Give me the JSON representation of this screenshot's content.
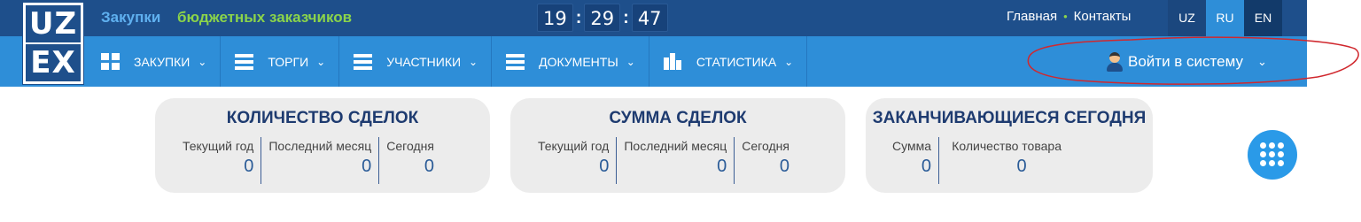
{
  "logo": {
    "line1": "UZ",
    "line2": "EX"
  },
  "brand": {
    "part1": "Закупки",
    "part2": "бюджетных заказчиков"
  },
  "clock": {
    "hours": "19",
    "minutes": "29",
    "seconds": "47",
    "separator": ":"
  },
  "toplinks": {
    "home": "Главная",
    "dot": "•",
    "contacts": "Контакты"
  },
  "languages": {
    "uz": "UZ",
    "ru": "RU",
    "en": "EN",
    "active": "RU"
  },
  "menu": {
    "items": [
      {
        "label": "ЗАКУПКИ",
        "icon": "grid-icon"
      },
      {
        "label": "ТОРГИ",
        "icon": "list-icon"
      },
      {
        "label": "УЧАСТНИКИ",
        "icon": "list-icon"
      },
      {
        "label": "ДОКУМЕНТЫ",
        "icon": "list-icon"
      },
      {
        "label": "СТАТИСТИКА",
        "icon": "bar-chart-icon"
      }
    ],
    "chevron": "⌄"
  },
  "login": {
    "label": "Войти в систему",
    "icon": "user-icon"
  },
  "cards": [
    {
      "title": "КОЛИЧЕСТВО СДЕЛОК",
      "columns": [
        {
          "label": "Текущий год",
          "value": "0"
        },
        {
          "label": "Последний месяц",
          "value": "0"
        },
        {
          "label": "Сегодня",
          "value": "0"
        }
      ]
    },
    {
      "title": "СУММА СДЕЛОК",
      "columns": [
        {
          "label": "Текущий год",
          "value": "0"
        },
        {
          "label": "Последний месяц",
          "value": "0"
        },
        {
          "label": "Сегодня",
          "value": "0"
        }
      ]
    },
    {
      "title": "ЗАКАНЧИВАЮЩИЕСЯ СЕГОДНЯ",
      "columns": [
        {
          "label": "Сумма",
          "value": "0"
        },
        {
          "label": "Количество товара",
          "value": "0"
        }
      ]
    }
  ],
  "fab": {
    "icon": "apps-grid-icon"
  },
  "colors": {
    "topbar": "#1e4f8b",
    "navbar": "#2e8ed8",
    "brand_blue": "#5fb0ef",
    "brand_green": "#8bd44a",
    "card_bg": "#ececec",
    "card_title": "#1e3b70",
    "annotation": "#d0282e"
  }
}
